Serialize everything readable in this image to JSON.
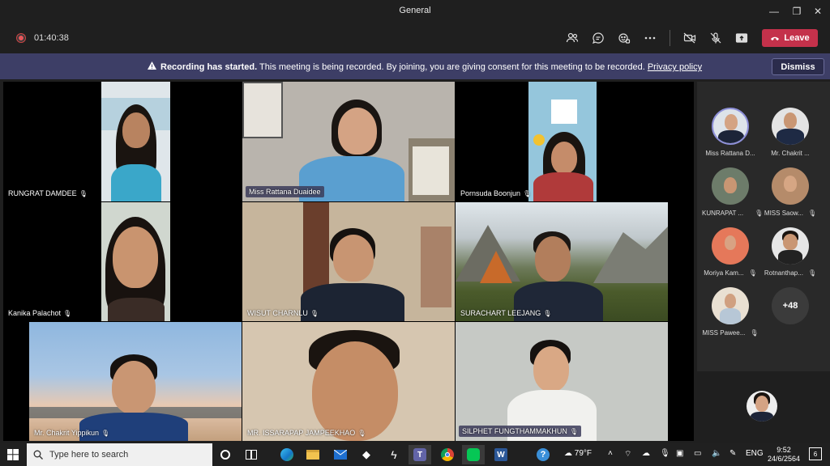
{
  "window": {
    "title": "General"
  },
  "toolbar": {
    "timer": "01:40:38",
    "leave_label": "Leave"
  },
  "banner": {
    "bold": "Recording has started.",
    "text": " This meeting is being recorded. By joining, you are giving consent for this meeting to be recorded. ",
    "link": "Privacy policy",
    "dismiss_label": "Dismiss"
  },
  "tiles": [
    {
      "name": "RUNGRAT  DAMDEE"
    },
    {
      "name": "Miss Rattana Duaidee"
    },
    {
      "name": "Pornsuda Boonjun"
    },
    {
      "name": "Kanika Palachot"
    },
    {
      "name": "WISUT CHARNLU"
    },
    {
      "name": "SURACHART LEEJANG"
    },
    {
      "name": "Mr. Chakrit Yippikun"
    },
    {
      "name": "MR. ISSARAPAP JAMPEEKHAO"
    },
    {
      "name": "SILPHET FUNGTHAMMAKHUN"
    }
  ],
  "roster": [
    {
      "name": "Miss Rattana D..."
    },
    {
      "name": "Mr. Chakrit ..."
    },
    {
      "name": "KUNRAPAT ..."
    },
    {
      "name": "MISS Saow..."
    },
    {
      "name": "Moriya Kam..."
    },
    {
      "name": "Rotnanthap..."
    },
    {
      "name": "MISS Pawee..."
    }
  ],
  "overflow_count": "+48",
  "taskbar": {
    "search_placeholder": "Type here to search",
    "weather": "79°F",
    "lang": "ENG",
    "time": "9:52",
    "date": "24/6/2564",
    "notifications": "6"
  },
  "colors": {
    "leave": "#c4314b",
    "banner": "#3d3e66",
    "accent_teams": "#6264a7"
  }
}
